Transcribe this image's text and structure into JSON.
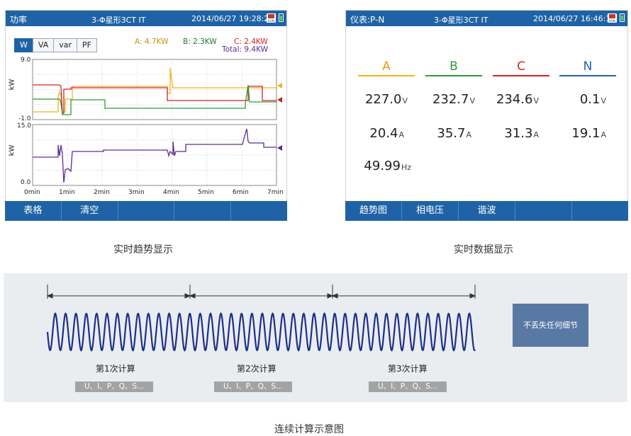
{
  "left_screen": {
    "title": "功率",
    "mode": "3-Φ星形3CT IT",
    "datetime": "2014/06/27 19:28:20",
    "run_badge": "RUN",
    "tabs": [
      "W",
      "VA",
      "var",
      "PF"
    ],
    "active_tab": "W",
    "legend": {
      "a": "A: 4.7KW",
      "b": "B: 2.3KW",
      "c": "C: 2.4KW",
      "total": "Total: 9.4KW"
    },
    "top_chart": {
      "ylabel": "kW",
      "ymax": "9.0",
      "ymin": "-1.0"
    },
    "bottom_chart": {
      "ylabel": "kW",
      "ymax": "15.0",
      "ymin": "0.0"
    },
    "x_ticks": [
      "0min",
      "1min",
      "2min",
      "3min",
      "4min",
      "5min",
      "6min",
      "7min"
    ],
    "softkeys": [
      "表格",
      "清空",
      "",
      "",
      ""
    ]
  },
  "right_screen": {
    "title": "仪表:P-N",
    "mode": "3-Φ星形3CT IT",
    "datetime": "2014/06/27 16:46:14",
    "run_badge": "RUN",
    "phases": [
      {
        "label": "A",
        "voltage": "227.0",
        "current": "20.4"
      },
      {
        "label": "B",
        "voltage": "232.7",
        "current": "35.7"
      },
      {
        "label": "C",
        "voltage": "234.6",
        "current": "31.3"
      },
      {
        "label": "N",
        "voltage": "0.1",
        "current": "19.1"
      }
    ],
    "voltage_unit": "V",
    "current_unit": "A",
    "frequency": "49.99",
    "frequency_unit": "Hz",
    "softkeys": [
      "趋势图",
      "相电压",
      "谐波",
      "",
      ""
    ]
  },
  "captions": {
    "left": "实时趋势显示",
    "right": "实时数据显示",
    "bottom": "连续计算示意图"
  },
  "calc_diagram": {
    "segments": [
      {
        "label": "第1次计算",
        "params": "U、I、P、Q、S..."
      },
      {
        "label": "第2次计算",
        "params": "U、I、P、Q、S..."
      },
      {
        "label": "第3次计算",
        "params": "U、I、P、Q、S..."
      }
    ],
    "note": "不丢失任何细节"
  },
  "colors": {
    "title_bar": "#1f63a6",
    "phase_a": "#f3b21c",
    "phase_b": "#2a9a3c",
    "phase_c": "#d32222",
    "total": "#5c2d91",
    "phase_n": "#1f63a6",
    "wave": "#1c2f8a",
    "note_box": "#5979a5"
  }
}
